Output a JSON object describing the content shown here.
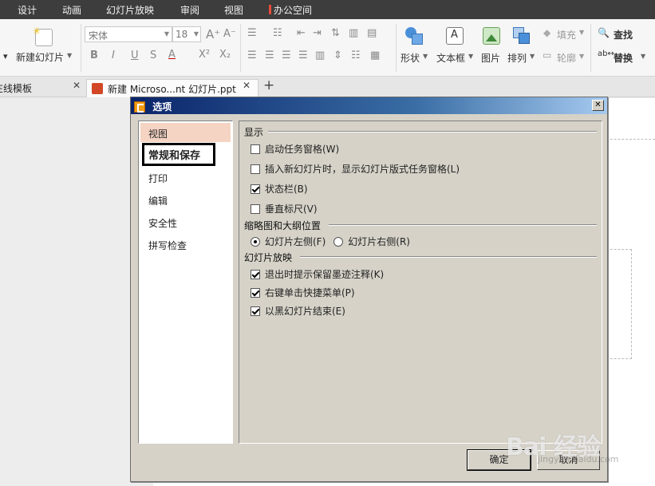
{
  "menubar": {
    "items": [
      "设计",
      "动画",
      "幻灯片放映",
      "审阅",
      "视图",
      "办公空间"
    ]
  },
  "ribbon": {
    "new_slide": "新建幻灯片",
    "font_name": "宋体",
    "font_size": "18",
    "shape": "形状",
    "textbox": "文本框",
    "picture": "图片",
    "arrange": "排列",
    "fill": "填充",
    "outline": "轮廓",
    "find": "查找",
    "replace": "替换"
  },
  "tabs": {
    "online_template": "在线模板",
    "doc_tab": "新建 Microso...nt 幻灯片.ppt",
    "add": "+"
  },
  "dialog": {
    "title": "选项",
    "nav": [
      "视图",
      "常规和保存",
      "打印",
      "编辑",
      "安全性",
      "拼写检查"
    ],
    "groups": {
      "display": "显示",
      "thumb": "缩略图和大纲位置",
      "show": "幻灯片放映"
    },
    "display_options": [
      {
        "label": "启动任务窗格(W)",
        "checked": false
      },
      {
        "label": "插入新幻灯片时，显示幻灯片版式任务窗格(L)",
        "checked": false
      },
      {
        "label": "状态栏(B)",
        "checked": true
      },
      {
        "label": "垂直标尺(V)",
        "checked": false
      }
    ],
    "thumb_options": [
      {
        "label": "幻灯片左侧(F)",
        "checked": true
      },
      {
        "label": "幻灯片右侧(R)",
        "checked": false
      }
    ],
    "show_options": [
      {
        "label": "退出时提示保留墨迹注释(K)",
        "checked": true
      },
      {
        "label": "右键单击快捷菜单(P)",
        "checked": true
      },
      {
        "label": "以黑幻灯片结束(E)",
        "checked": true
      }
    ],
    "ok": "确定",
    "cancel": "取消"
  },
  "watermark": {
    "brand": "Bai 经验",
    "url": "jingyan.baidu.com"
  },
  "colors": {
    "menubar_bg": "#3d3d3d",
    "dialog_bg": "#d6d2c8",
    "nav_selected": "#f5d4c4",
    "accent": "#e74c3c"
  }
}
